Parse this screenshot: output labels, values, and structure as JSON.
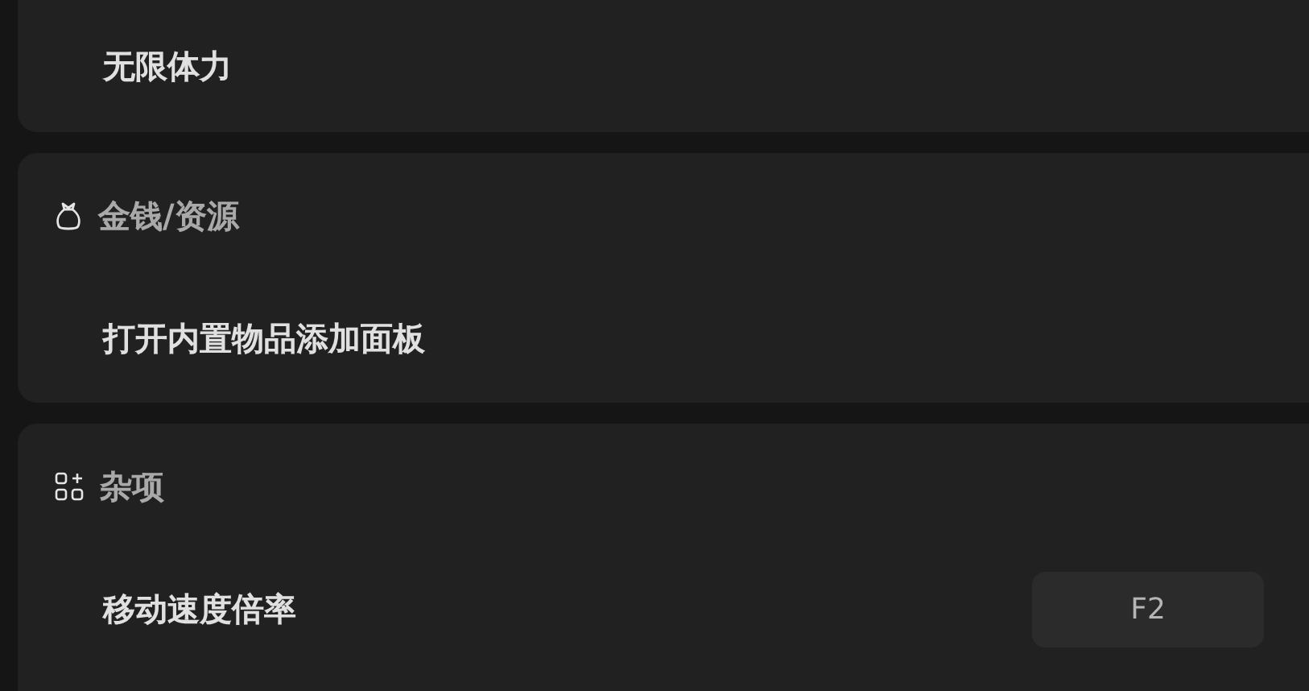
{
  "sections": [
    {
      "items": [
        {
          "label": "无限体力"
        }
      ]
    },
    {
      "title": "金钱/资源",
      "kind": "money",
      "items": [
        {
          "label": "打开内置物品添加面板"
        }
      ]
    },
    {
      "title": "杂项",
      "kind": "misc",
      "items": [
        {
          "label": "移动速度倍率",
          "hotkey": "F2"
        }
      ]
    }
  ]
}
